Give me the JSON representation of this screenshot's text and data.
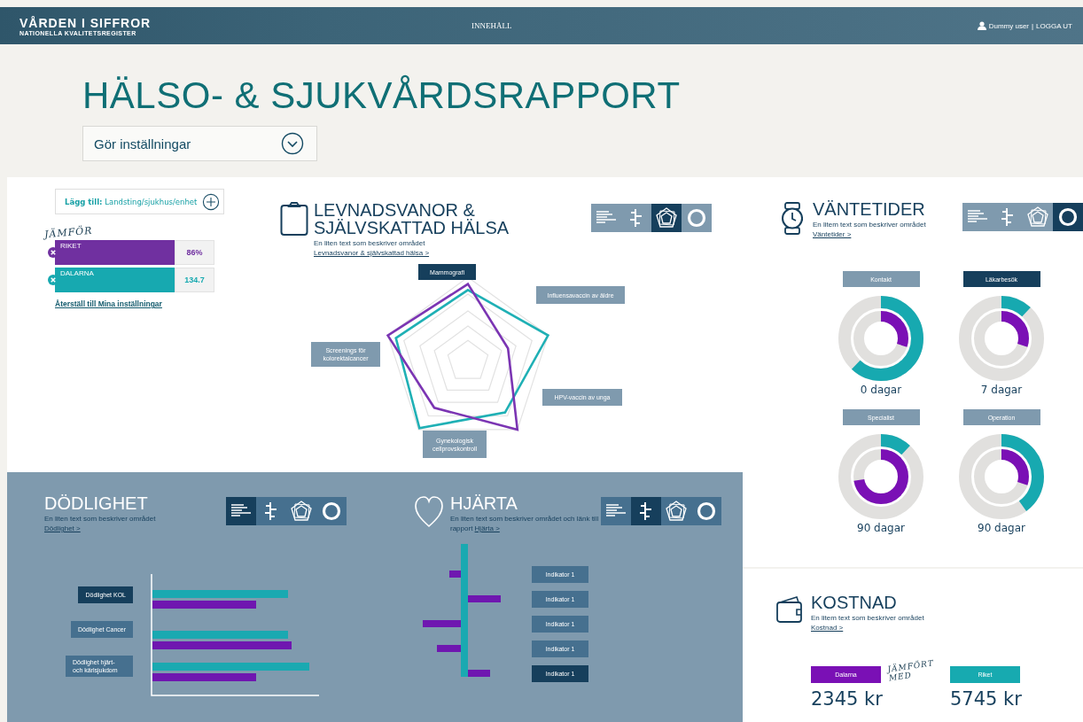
{
  "top_bar": {
    "logo_title": "VÅRDEN I SIFFROR",
    "logo_subtitle": "NATIONELLA KVALITETSREGISTER",
    "nav_link": "INNEHÅLL",
    "user_name": "Dummy user",
    "separator": "|",
    "logout": "LOGGA UT"
  },
  "page_title": "HÄLSO- & SJUKVÅRDSRAPPORT",
  "settings_dropdown": {
    "label": "Gör inställningar"
  },
  "compare": {
    "add_button": "**Lägg till:** Landsting/sjukhus/enhet",
    "heading": "JÄMFÖR",
    "items": [
      {
        "name": "RIKET",
        "value": "86%",
        "color": "#7030a0"
      },
      {
        "name": "DALARNA",
        "value": "134.7",
        "color": "#17a9b0"
      }
    ],
    "reset_link": "Återställ till Mina inställningar"
  },
  "levnadsvanor": {
    "title_lines": [
      "LEVNADSVANOR &",
      "SJÄLVSKATTAD HÄLSA"
    ],
    "description": "En liten text som beskriver området",
    "link": "Levnadsvanor & självskattad hälsa >",
    "views": [
      {
        "kind": "bars",
        "selected": false
      },
      {
        "kind": "diverging",
        "selected": false
      },
      {
        "kind": "radar",
        "selected": true
      },
      {
        "kind": "donut",
        "selected": false
      }
    ],
    "labels": [
      {
        "text": "Mammografi",
        "selected": true
      },
      {
        "text": "Influensavaccin av äldre",
        "selected": false
      },
      {
        "text": "HPV-vaccin av unga",
        "selected": false
      },
      {
        "text": "Gynekologisk cellprovskontroll",
        "selected": false
      },
      {
        "text": "Screenings för kolorektalcancer",
        "selected": false
      }
    ]
  },
  "dodlighet": {
    "title": "DÖDLIGHET",
    "description": "En liten text som beskriver området",
    "link": "Dödlighet >",
    "views": [
      {
        "kind": "bars",
        "selected": true
      },
      {
        "kind": "diverging",
        "selected": false
      },
      {
        "kind": "radar",
        "selected": false
      },
      {
        "kind": "donut",
        "selected": false
      }
    ],
    "labels": [
      {
        "text": "Dödlighet KOL",
        "selected": true
      },
      {
        "text": "Dödlighet Cancer",
        "selected": false
      },
      {
        "text": "Dödlighet hjärt- och kärlsjukdom",
        "selected": false
      }
    ]
  },
  "hjarta": {
    "title": "HJÄRTA",
    "description": "En liten text som beskriver området och länk till rapport",
    "link": "Hjärta >",
    "views": [
      {
        "kind": "bars",
        "selected": false
      },
      {
        "kind": "diverging",
        "selected": true
      },
      {
        "kind": "radar",
        "selected": false
      },
      {
        "kind": "donut",
        "selected": false
      }
    ],
    "labels": [
      {
        "text": "Indikator 1",
        "selected": false
      },
      {
        "text": "Indikator 1",
        "selected": false
      },
      {
        "text": "Indikator 1",
        "selected": false
      },
      {
        "text": "Indikator 1",
        "selected": false
      },
      {
        "text": "Indikator 1",
        "selected": true
      }
    ]
  },
  "vantetider": {
    "title": "VÄNTETIDER",
    "description": "En litem text som beskriver området",
    "link": "Väntetider >",
    "views": [
      {
        "kind": "bars",
        "selected": false
      },
      {
        "kind": "diverging",
        "selected": false
      },
      {
        "kind": "radar",
        "selected": false
      },
      {
        "kind": "donut",
        "selected": true
      }
    ],
    "donuts": [
      {
        "label": "Kontakt",
        "selected": false,
        "value": "0 dagar",
        "rings": [
          {
            "level": 0.62,
            "color": "#17a9b0"
          },
          {
            "level": 0.3,
            "color": "#7a10b5"
          }
        ]
      },
      {
        "label": "Läkarbesök",
        "selected": true,
        "value": "7 dagar",
        "rings": [
          {
            "level": 0.12,
            "color": "#17a9b0"
          },
          {
            "level": 0.3,
            "color": "#7a10b5"
          }
        ]
      },
      {
        "label": "Specialist",
        "selected": false,
        "value": "90 dagar",
        "rings": [
          {
            "level": 0.12,
            "color": "#17a9b0"
          },
          {
            "level": 0.72,
            "color": "#7a10b5"
          }
        ]
      },
      {
        "label": "Operation",
        "selected": false,
        "value": "90 dagar",
        "rings": [
          {
            "level": 0.4,
            "color": "#17a9b0"
          },
          {
            "level": 0.3,
            "color": "#7a10b5"
          }
        ]
      }
    ]
  },
  "kostnad": {
    "title": "KOSTNAD",
    "description": "En litem text som beskriver området",
    "link": "Kostnad >",
    "connector": "JÄMFÖRT MED",
    "items": [
      {
        "name": "Dalarna",
        "value": "2345 kr",
        "color": "#7a10b5"
      },
      {
        "name": "Riket",
        "value": "5745 kr",
        "color": "#17aab0"
      }
    ]
  }
}
